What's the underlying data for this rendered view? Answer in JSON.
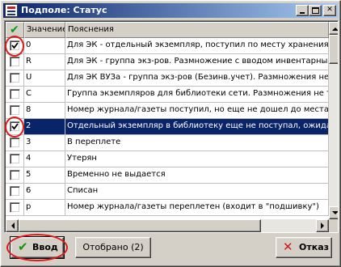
{
  "window": {
    "title": "Подполе: Статус",
    "icon": "catalog-app-icon"
  },
  "titlebar_buttons": [
    "minimize-button",
    "maximize-button",
    "close-button"
  ],
  "grid": {
    "columns": [
      "Значение",
      "Пояснения"
    ],
    "check_column_icon": "check-icon",
    "rows": [
      {
        "checked": true,
        "value": "0",
        "desc": "Для ЭК - отдельный экземпляр, поступил по месту хранения",
        "selected": false
      },
      {
        "checked": false,
        "value": "R",
        "desc": "Для ЭК - группа экз-ров. Размножение с вводом инвентарных",
        "selected": false
      },
      {
        "checked": false,
        "value": "U",
        "desc": "Для ЭК ВУЗа - группа экз-ров (Безинв.учет). Размножения не",
        "selected": false
      },
      {
        "checked": false,
        "value": "C",
        "desc": "Группа экземпляров для библиотеки сети. Размножения не тр",
        "selected": false
      },
      {
        "checked": false,
        "value": "8",
        "desc": "Номер журнала/газеты поступил, но еще не дошел до места х",
        "selected": false
      },
      {
        "checked": true,
        "value": "2",
        "desc": "Отдельный экземпляр в библиотеку еще не поступал, ожидае",
        "selected": true
      },
      {
        "checked": false,
        "value": "3",
        "desc": "В переплете",
        "selected": false
      },
      {
        "checked": false,
        "value": "4",
        "desc": "Утерян",
        "selected": false
      },
      {
        "checked": false,
        "value": "5",
        "desc": "Временно не выдается",
        "selected": false
      },
      {
        "checked": false,
        "value": "6",
        "desc": "Списан",
        "selected": false
      },
      {
        "checked": false,
        "value": "p",
        "desc": "Номер журнала/газеты переплетен (входит в \"подшивку\")",
        "selected": false
      }
    ]
  },
  "buttons": {
    "ok": "Ввод",
    "selected": "Отобрано (2)",
    "cancel": "Отказ"
  },
  "colors": {
    "selection": "#0a246a",
    "highlight_ring": "#e01818",
    "ok_check": "#0a9a0a",
    "cancel_x": "#d01818"
  }
}
